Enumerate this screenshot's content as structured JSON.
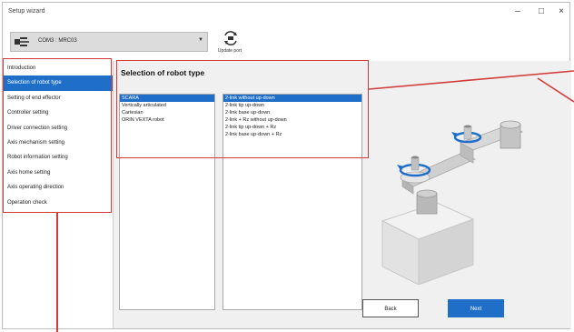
{
  "window": {
    "title": "Setup wizard",
    "minimize": "–",
    "maximize": "□",
    "close": "×"
  },
  "toolbar": {
    "port_value": "COM3 : MRC03",
    "update_label": "Update port"
  },
  "sidebar": {
    "items": [
      {
        "label": "Introduction"
      },
      {
        "label": "Selection of robot type"
      },
      {
        "label": "Setting of end effector"
      },
      {
        "label": "Controller setting"
      },
      {
        "label": "Driver connection setting"
      },
      {
        "label": "Axis mechanism setting"
      },
      {
        "label": "Robot information setting"
      },
      {
        "label": "Axis home setting"
      },
      {
        "label": "Axis operating direction"
      },
      {
        "label": "Operation check"
      }
    ],
    "selected_index": 1
  },
  "main": {
    "heading": "Selection of robot type",
    "robot_types": [
      "SCARA",
      "Vertically articulated",
      "Cartesian",
      "ORIN VEXTA robot"
    ],
    "robot_types_selected": 0,
    "subtypes": [
      "2-link without up-down",
      "2-link tip up-down",
      "2-link base up-down",
      "2-link + Rz without up-down",
      "2-link tip up-down + Rz",
      "2-link base up-down + Rz"
    ],
    "subtypes_selected": 0,
    "back_label": "Back",
    "next_label": "Next"
  },
  "colors": {
    "accent": "#1f6fc8",
    "highlight": "#d33a3a"
  }
}
